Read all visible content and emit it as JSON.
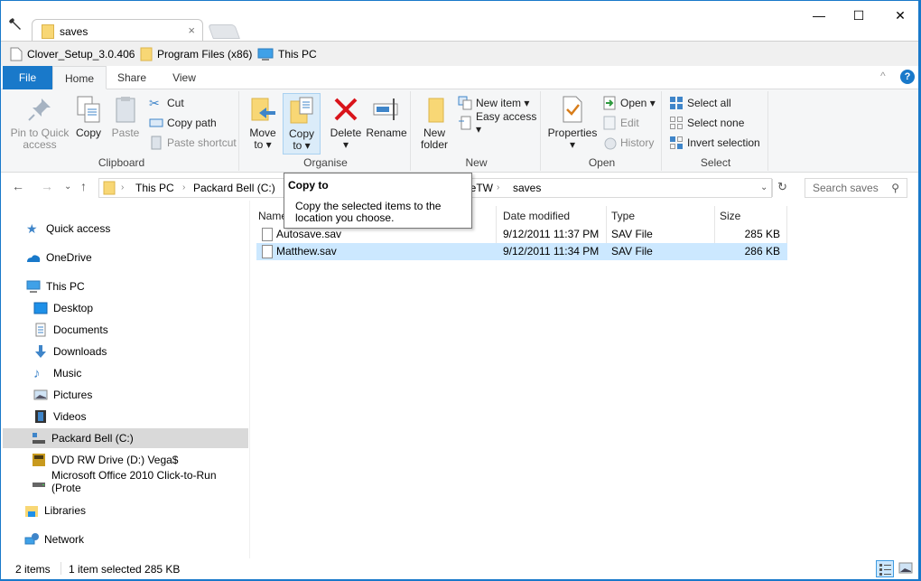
{
  "window": {
    "tab_title": "saves",
    "controls": {
      "minimize": "—",
      "maximize": "☐",
      "close": "✕"
    }
  },
  "bookmarks": [
    {
      "label": "Clover_Setup_3.0.406",
      "icon": "file-icon"
    },
    {
      "label": "Program Files (x86)",
      "icon": "folder-icon"
    },
    {
      "label": "This PC",
      "icon": "computer-icon"
    }
  ],
  "ribbon_tabs": [
    {
      "label": "File"
    },
    {
      "label": "Home"
    },
    {
      "label": "Share"
    },
    {
      "label": "View"
    }
  ],
  "ribbon": {
    "clipboard": {
      "label": "Clipboard",
      "pin": "Pin to Quick",
      "pin2": "access",
      "copy": "Copy",
      "paste": "Paste",
      "cut": "Cut",
      "copy_path": "Copy path",
      "paste_shortcut": "Paste shortcut"
    },
    "organise": {
      "label": "Organise",
      "move": "Move",
      "move2": "to ▾",
      "copy": "Copy",
      "copy2": "to ▾",
      "delete": "Delete",
      "delete2": "▾",
      "rename": "Rename"
    },
    "new": {
      "label": "New",
      "new_folder": "New",
      "new_folder2": "folder",
      "new_item": "New item ▾",
      "easy_access": "Easy access ▾"
    },
    "open": {
      "label": "Open",
      "properties": "Properties",
      "properties2": "▾",
      "open": "Open ▾",
      "edit": "Edit",
      "history": "History"
    },
    "select": {
      "label": "Select",
      "select_all": "Select all",
      "select_none": "Select none",
      "invert": "Invert selection"
    }
  },
  "address": {
    "crumbs": [
      "This PC",
      "Packard Bell (C:)",
      "neTW",
      "saves"
    ],
    "search_placeholder": "Search saves"
  },
  "tooltip": {
    "title": "Copy to",
    "description": "Copy the selected items to the location you choose."
  },
  "nav": [
    {
      "label": "Quick access"
    },
    {
      "label": "OneDrive"
    },
    {
      "label": "This PC"
    },
    {
      "label": "Desktop"
    },
    {
      "label": "Documents"
    },
    {
      "label": "Downloads"
    },
    {
      "label": "Music"
    },
    {
      "label": "Pictures"
    },
    {
      "label": "Videos"
    },
    {
      "label": "Packard Bell (C:)"
    },
    {
      "label": "DVD RW Drive (D:) Vega$"
    },
    {
      "label": "Microsoft Office 2010 Click-to-Run (Prote"
    },
    {
      "label": "Libraries"
    },
    {
      "label": "Network"
    }
  ],
  "columns": [
    "Name",
    "Date modified",
    "Type",
    "Size"
  ],
  "files": [
    {
      "name": "Autosave.sav",
      "date": "9/12/2011 11:37 PM",
      "type": "SAV File",
      "size": "285 KB",
      "selected": false
    },
    {
      "name": "Matthew.sav",
      "date": "9/12/2011 11:34 PM",
      "type": "SAV File",
      "size": "286 KB",
      "selected": true
    }
  ],
  "status": {
    "count": "2 items",
    "selection": "1 item selected  285 KB"
  },
  "colors": {
    "accent": "#1979ca",
    "selection": "#cce8ff",
    "nav_selected": "#d9d9d9"
  }
}
